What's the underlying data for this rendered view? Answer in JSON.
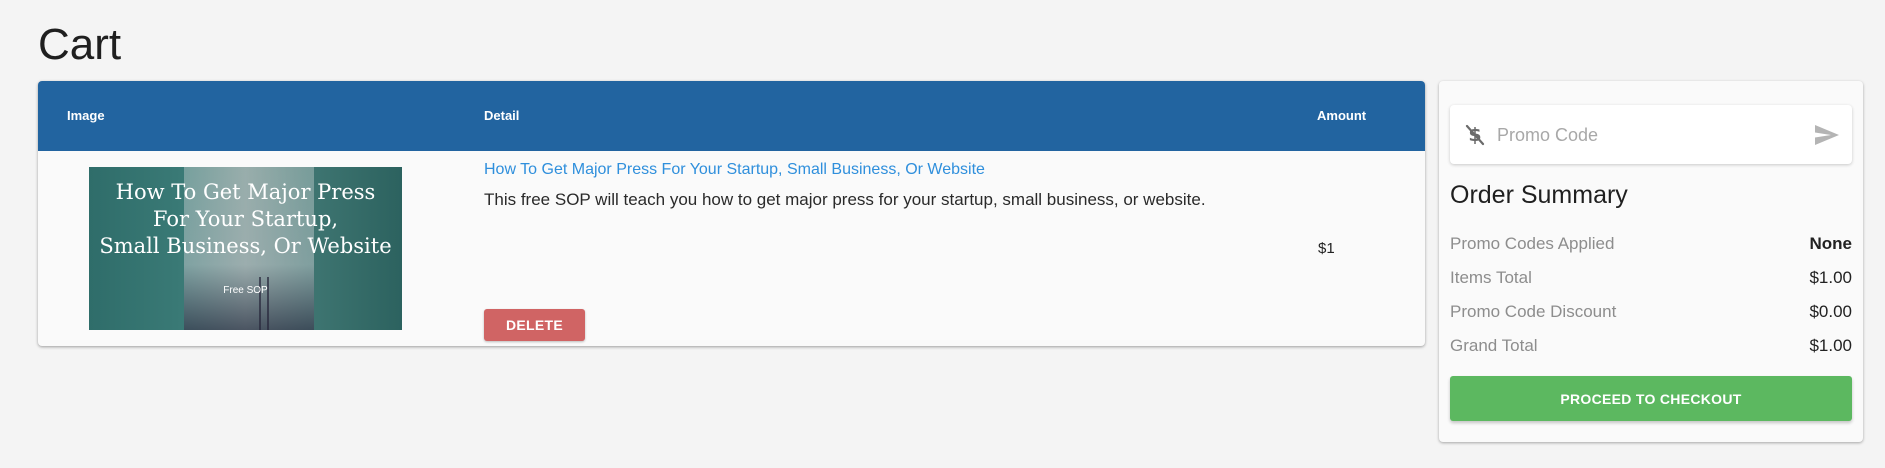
{
  "page": {
    "title": "Cart"
  },
  "cart": {
    "columns": {
      "image": "Image",
      "detail": "Detail",
      "amount": "Amount"
    },
    "items": [
      {
        "thumbnail_title": "How To Get Major Press\nFor Your Startup,\nSmall Business, Or Website",
        "thumbnail_subtitle": "Free SOP",
        "title": "How To Get Major Press For Your Startup, Small Business, Or Website",
        "description": "This free SOP will teach you how to get major press for your startup, small business, or website.",
        "amount": "$1",
        "delete_label": "DELETE"
      }
    ],
    "header_color": "#2264a0",
    "link_color": "#2f8fdc",
    "delete_color": "#d06464"
  },
  "summary": {
    "promo_placeholder": "Promo Code",
    "promo_icon": "no-dollar-icon",
    "submit_icon": "send-icon",
    "title": "Order Summary",
    "rows": [
      {
        "label": "Promo Codes Applied",
        "value": "None"
      },
      {
        "label": "Items Total",
        "value": "$1.00"
      },
      {
        "label": "Promo Code Discount",
        "value": "$0.00"
      },
      {
        "label": "Grand Total",
        "value": "$1.00"
      }
    ],
    "checkout_label": "PROCEED TO CHECKOUT",
    "checkout_color": "#5cb860"
  }
}
